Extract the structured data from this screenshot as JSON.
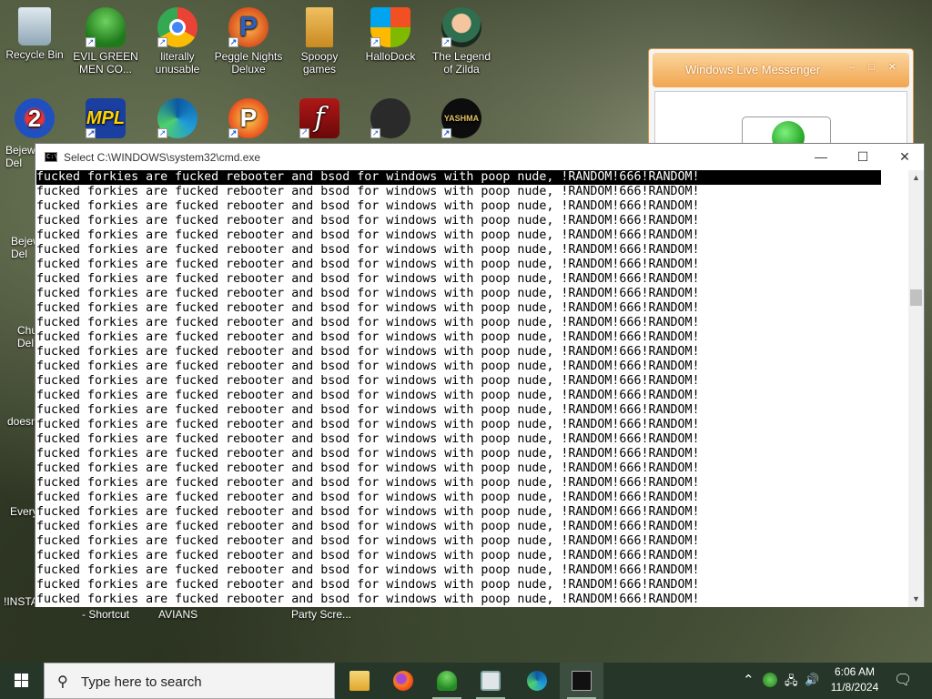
{
  "desktop": {
    "icons": [
      {
        "id": "recycle",
        "label": "Recycle Bin",
        "color": "#9fb7c8"
      },
      {
        "id": "evil",
        "label": "EVIL GREEN MEN CO...",
        "color": "#3fa33a"
      },
      {
        "id": "chrome",
        "label": "literally unusable",
        "color": "#e4452f"
      },
      {
        "id": "peggle",
        "label": "Peggle Nights Deluxe",
        "color": "#e88a1e"
      },
      {
        "id": "spoopy",
        "label": "Spoopy games",
        "color": "#d9a030"
      },
      {
        "id": "hallodock",
        "label": "HalloDock",
        "color": "#2f7fd8"
      },
      {
        "id": "zilda",
        "label": "The Legend of Zilda",
        "color": "#4a8a5a"
      },
      {
        "id": "row2a",
        "label": "",
        "color": "#2a5fc0"
      },
      {
        "id": "mpl",
        "label": "",
        "color": "#1a3fa0"
      },
      {
        "id": "edge",
        "label": "",
        "color": "#1f9bd8"
      },
      {
        "id": "peggle2",
        "label": "",
        "color": "#e8501e"
      },
      {
        "id": "flash",
        "label": "",
        "color": "#8a1010"
      },
      {
        "id": "shield",
        "label": "",
        "color": "#333333"
      },
      {
        "id": "yashma",
        "label": "",
        "color": "#111111"
      }
    ],
    "partial_labels": {
      "bejew1": "Bejew\nDel",
      "bejew2": "Bejew\nDel",
      "chu": "Chu\nDel",
      "doesn": "doesn",
      "every": "Every",
      "insta": "!INSTA",
      "shortcut": "- Shortcut",
      "avians": "AVIANS",
      "party": "Party Scre..."
    }
  },
  "messenger": {
    "title": "Windows Live Messenger",
    "controls": "‒ □ ✕"
  },
  "cmd": {
    "title": "Select C:\\WINDOWS\\system32\\cmd.exe",
    "icon_text": "C:\\",
    "min": "—",
    "max": "☐",
    "close": "✕",
    "line_text": "fucked forkies are fucked rebooter and bsod for windows with poop nude, !RANDOM!666!RANDOM!",
    "line_count": 30,
    "scroll_up": "▲",
    "scroll_down": "▼"
  },
  "taskbar": {
    "search_placeholder": "Type here to search",
    "search_icon": "magnifier-icon",
    "apps": [
      {
        "id": "explorer",
        "icon": "folder-icon",
        "color": "#f2c14e"
      },
      {
        "id": "firefox",
        "icon": "firefox-icon",
        "color": "#e66a1f"
      },
      {
        "id": "messenger",
        "icon": "messenger-people-icon",
        "color": "#3fa33a"
      },
      {
        "id": "window",
        "icon": "app-window-icon",
        "color": "#cfd8dc"
      },
      {
        "id": "edge",
        "icon": "edge-icon",
        "color": "#1f9bd8"
      },
      {
        "id": "cmd",
        "icon": "terminal-icon",
        "color": "#111111"
      }
    ],
    "tray": {
      "chevron": "⌃",
      "volume": "🔊",
      "network": "🖧"
    },
    "time": "6:06 AM",
    "date": "11/8/2024",
    "notification": "🗨"
  }
}
